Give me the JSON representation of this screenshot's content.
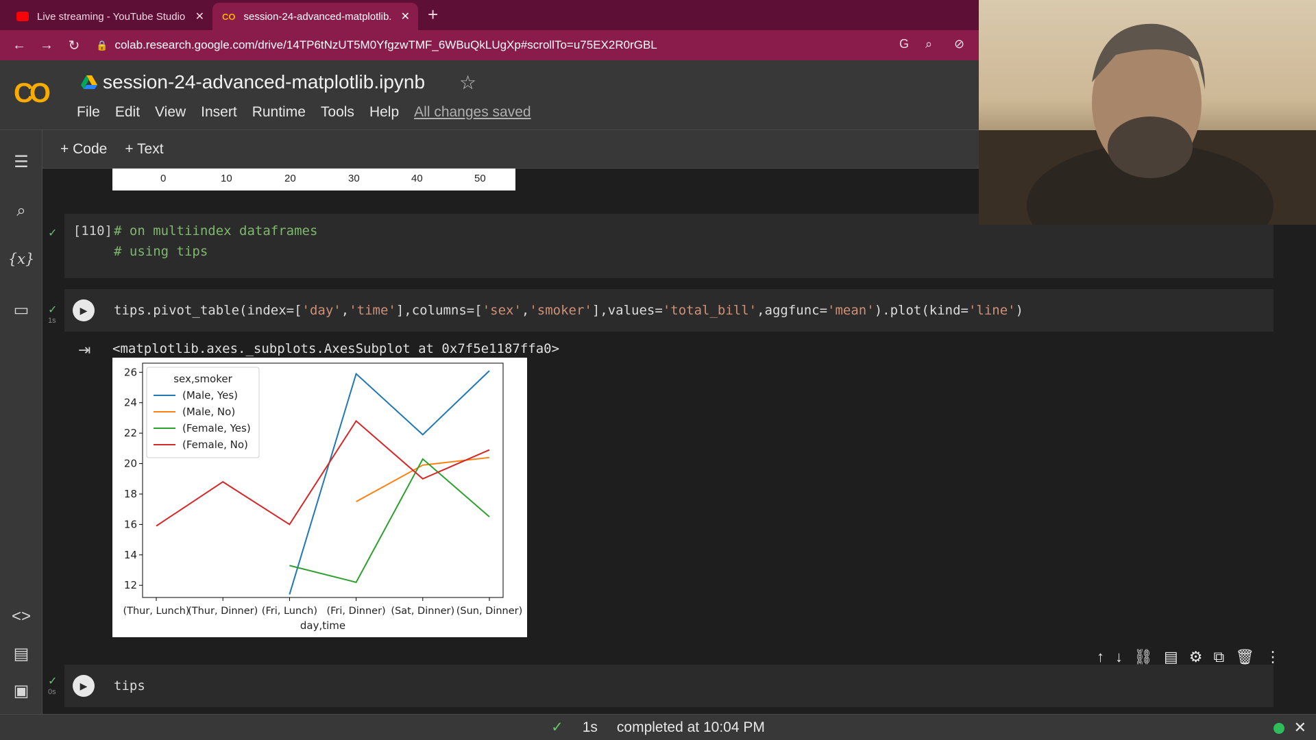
{
  "browser": {
    "tabs": [
      {
        "title": "Live streaming - YouTube Studio",
        "favicon_color": "#ff0000"
      },
      {
        "title": "session-24-advanced-matplotlib.",
        "favicon_color": "#f9ab00"
      }
    ],
    "url": "colab.research.google.com/drive/14TP6tNzUT5M0YfgzwTMF_6WBuQkLUgXp#scrollTo=u75EX2R0rGBL"
  },
  "colab": {
    "logo": "CO",
    "notebook_title": "session-24-advanced-matplotlib.ipynb",
    "menu": [
      "File",
      "Edit",
      "View",
      "Insert",
      "Runtime",
      "Tools",
      "Help"
    ],
    "save_status": "All changes saved",
    "toolbar": {
      "add_code": "Code",
      "add_text": "Text"
    }
  },
  "previous_plot_ticks": [
    "0",
    "10",
    "20",
    "30",
    "40",
    "50"
  ],
  "cells": {
    "comment_cell": {
      "exec_count": "[110]",
      "line1": "# on multiindex dataframes",
      "line2": "# using tips"
    },
    "plot_cell": {
      "exec_time": "1s",
      "code_parts": [
        {
          "t": "tips.pivot_table(index=[",
          "c": "plain"
        },
        {
          "t": "'day'",
          "c": "str"
        },
        {
          "t": ",",
          "c": "plain"
        },
        {
          "t": "'time'",
          "c": "str"
        },
        {
          "t": "],columns=[",
          "c": "plain"
        },
        {
          "t": "'sex'",
          "c": "str"
        },
        {
          "t": ",",
          "c": "plain"
        },
        {
          "t": "'smoker'",
          "c": "str"
        },
        {
          "t": "],values=",
          "c": "plain"
        },
        {
          "t": "'total_bill'",
          "c": "str"
        },
        {
          "t": ",aggfunc=",
          "c": "plain"
        },
        {
          "t": "'mean'",
          "c": "str"
        },
        {
          "t": ").plot(kind=",
          "c": "plain"
        },
        {
          "t": "'line'",
          "c": "str"
        },
        {
          "t": ")",
          "c": "plain"
        }
      ],
      "output_text": "<matplotlib.axes._subplots.AxesSubplot at 0x7f5e1187ffa0>"
    },
    "tips_cell": {
      "exec_time": "0s",
      "code": "tips"
    }
  },
  "chart_data": {
    "type": "line",
    "categories": [
      "(Thur, Lunch)",
      "(Thur, Dinner)",
      "(Fri, Lunch)",
      "(Fri, Dinner)",
      "(Sat, Dinner)",
      "(Sun, Dinner)"
    ],
    "xlabel": "day,time",
    "ylabel": "",
    "ylim": [
      11.2,
      26.6
    ],
    "yticks": [
      12,
      14,
      16,
      18,
      20,
      22,
      24,
      26
    ],
    "legend_title": "sex,smoker",
    "legend_position": "upper-left",
    "series": [
      {
        "name": "(Male, Yes)",
        "color": "#1f77b4",
        "values": [
          null,
          null,
          11.4,
          25.9,
          21.9,
          26.1
        ]
      },
      {
        "name": "(Male, No)",
        "color": "#ff7f0e",
        "values": [
          null,
          null,
          null,
          17.5,
          19.9,
          20.4
        ]
      },
      {
        "name": "(Female, Yes)",
        "color": "#2ca02c",
        "values": [
          null,
          null,
          13.3,
          12.2,
          20.3,
          16.5
        ]
      },
      {
        "name": "(Female, No)",
        "color": "#d62728",
        "values": [
          15.9,
          18.8,
          16.0,
          22.8,
          19.0,
          20.9
        ]
      }
    ]
  },
  "statusbar": {
    "duration": "1s",
    "message": "completed at 10:04 PM"
  }
}
